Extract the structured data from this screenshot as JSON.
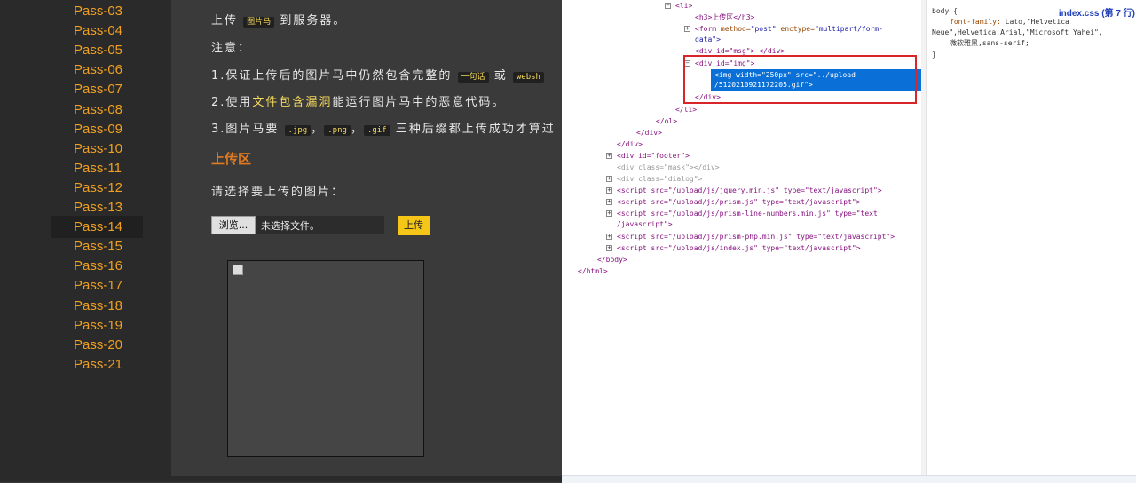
{
  "sidebar": {
    "items": [
      "Pass-03",
      "Pass-04",
      "Pass-05",
      "Pass-06",
      "Pass-07",
      "Pass-08",
      "Pass-09",
      "Pass-10",
      "Pass-11",
      "Pass-12",
      "Pass-13",
      "Pass-14",
      "Pass-15",
      "Pass-16",
      "Pass-17",
      "Pass-18",
      "Pass-19",
      "Pass-20",
      "Pass-21"
    ],
    "active": "Pass-14"
  },
  "main": {
    "line1_pre": "上传",
    "line1_code": "图片马",
    "line1_post": "到服务器。",
    "note": "注意：",
    "item1_pre": "1.保证上传后的图片马中仍然包含完整的",
    "item1_code1": "一句话",
    "item1_mid": "或",
    "item1_code2": "websh",
    "item2_pre": "2.使用",
    "item2_hl": "文件包含漏洞",
    "item2_post": "能运行图片马中的恶意代码。",
    "item3_pre": "3.图片马要",
    "item3_code1": ".jpg",
    "item3_code2": ".png",
    "item3_code3": ".gif",
    "item3_post": "三种后缀都上传成功才算过",
    "comma": "，",
    "upload_title": "上传区",
    "select_label": "请选择要上传的图片：",
    "browse_label": "浏览...",
    "no_file": "未选择文件。",
    "upload_button": "上传"
  },
  "devtools": {
    "dom": {
      "l_li": "<li>",
      "l_h3": "<h3>上传区</h3>",
      "l_form1_tag": "<form",
      "l_form1_a1": "method=",
      "l_form1_v1": "\"post\"",
      "l_form1_a2": "enctype=",
      "l_form1_v2": "\"multipart/form-",
      "l_form2": "data\">",
      "l_msg": "<div id=\"msg\"> </div>",
      "l_img_div": "<div id=\"img\">",
      "l_img1": "<img width=\"250px\" src=\"../upload",
      "l_img2": "/5120210921172205.gif\">",
      "l_div_close": "</div>",
      "l_li_close": "</li>",
      "l_ol_close": "</ol>",
      "l_div_close2": "</div>",
      "l_div_close3": "</div>",
      "l_footer": "<div id=\"footer\">",
      "l_mask": "<div class=\"mask\"></div>",
      "l_dialog": "<div class=\"dialog\">",
      "l_s1": "<script src=\"/upload/js/jquery.min.js\" type=\"text/javascript\">",
      "l_s2": "<script src=\"/upload/js/prism.js\" type=\"text/javascript\">",
      "l_s3a": "<script src=\"/upload/js/prism-line-numbers.min.js\" type=\"text",
      "l_s3b": "/javascript\">",
      "l_s4": "<script src=\"/upload/js/prism-php.min.js\" type=\"text/javascript\">",
      "l_s5": "<script src=\"/upload/js/index.js\" type=\"text/javascript\">",
      "l_body_close": "</body>",
      "l_html_close": "</html>"
    },
    "css": {
      "file": "index.css (第 7 行)",
      "selector": "body {",
      "prop": "font-family:",
      "v1": "Lato,\"Helvetica",
      "v2": "Neue\",Helvetica,Arial,\"Microsoft Yahei\",",
      "v3": "微软雅黑,sans-serif;",
      "close": "}"
    }
  }
}
